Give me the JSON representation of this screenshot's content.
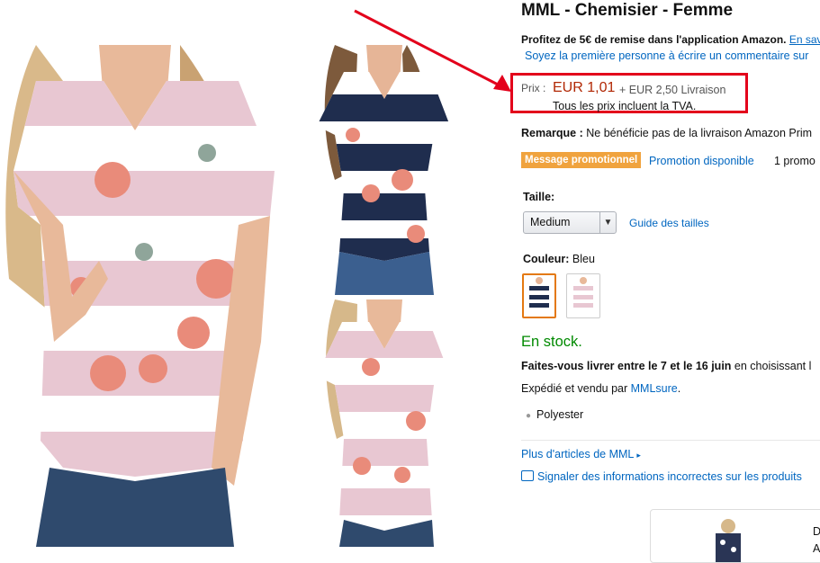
{
  "product": {
    "title": "MML - Chemisier - Femme",
    "offer_text": "Profitez de 5€ de remise dans l'application Amazon.",
    "offer_link": "En sav",
    "first_review": "Soyez la première personne à écrire un commentaire sur"
  },
  "price": {
    "label": "Prix :",
    "value": "EUR 1,01",
    "shipping": "+ EUR 2,50 Livraison",
    "tax_note": "Tous les prix incluent la TVA."
  },
  "remark": {
    "label": "Remarque :",
    "text": "Ne bénéficie pas de la livraison Amazon Prim"
  },
  "promo": {
    "badge": "Message promotionnel",
    "link": "Promotion disponible",
    "count": "1 promo"
  },
  "size": {
    "label": "Taille:",
    "selected": "Medium",
    "guide": "Guide des tailles"
  },
  "color": {
    "label": "Couleur:",
    "value": "Bleu"
  },
  "availability": {
    "stock": "En stock.",
    "delivery_bold": "Faites-vous livrer entre le 7 et le 16 juin",
    "delivery_rest": "en choisissant l",
    "sold_by_prefix": "Expédié et vendu par",
    "seller": "MMLsure",
    "bullet": "Polyester"
  },
  "links": {
    "more": "Plus d'articles de MML",
    "report": "Signaler des informations incorrectes sur les produits"
  },
  "ad": {
    "letter1": "D",
    "letter2": "A"
  },
  "colors": {
    "price_red": "#b12704",
    "link_blue": "#0066c0",
    "stock_green": "#008a00",
    "promo_orange": "#f0a33e",
    "annotation_red": "#e3001b"
  }
}
